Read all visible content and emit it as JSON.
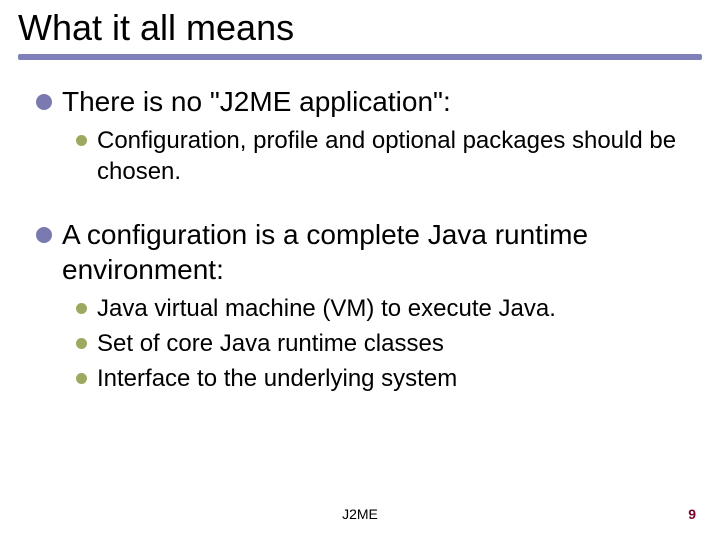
{
  "title": "What it all means",
  "points": {
    "p1": {
      "text_a": "There",
      "text_b": " is no \"J2ME application\":",
      "sub": [
        "Configuration, profile and optional packages should be chosen."
      ]
    },
    "p2": {
      "text_a": "A",
      "text_b": " configuration is a complete Java runtime environment:",
      "sub": [
        "Java virtual machine (VM) to execute Java.",
        "Set of core Java runtime classes",
        "Interface to the underlying system"
      ]
    }
  },
  "footer": {
    "center": "J2ME",
    "page": "9"
  }
}
